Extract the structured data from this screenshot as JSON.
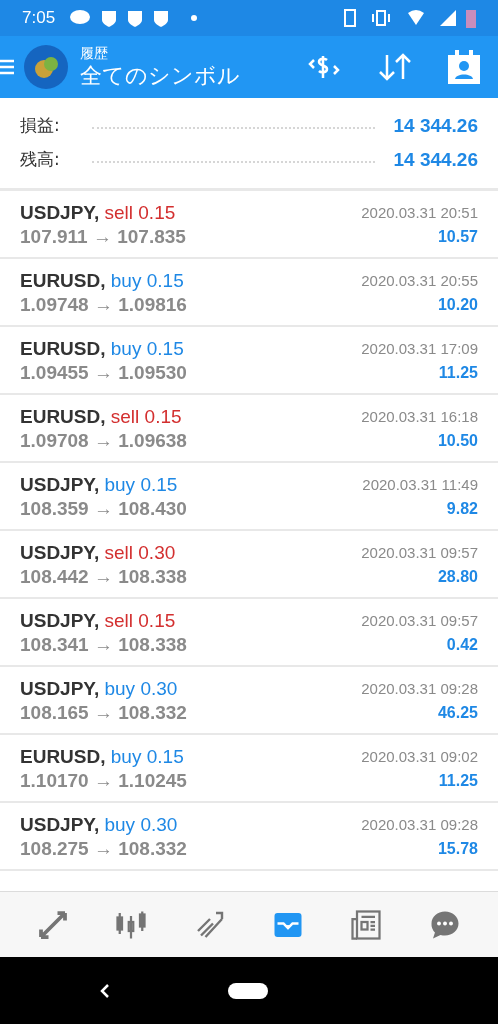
{
  "status_bar": {
    "time": "7:05"
  },
  "header": {
    "subtitle": "履歴",
    "title": "全てのシンボル"
  },
  "summary": [
    {
      "label": "損益:",
      "value": "14 344.26"
    },
    {
      "label": "残高:",
      "value": "14 344.26"
    }
  ],
  "trades": [
    {
      "symbol": "USDJPY,",
      "side": "sell",
      "lot": "0.15",
      "prices": "107.911 → 107.835",
      "time": "2020.03.31 20:51",
      "profit": "10.57"
    },
    {
      "symbol": "EURUSD,",
      "side": "buy",
      "lot": "0.15",
      "prices": "1.09748 → 1.09816",
      "time": "2020.03.31 20:55",
      "profit": "10.20"
    },
    {
      "symbol": "EURUSD,",
      "side": "buy",
      "lot": "0.15",
      "prices": "1.09455 → 1.09530",
      "time": "2020.03.31 17:09",
      "profit": "11.25"
    },
    {
      "symbol": "EURUSD,",
      "side": "sell",
      "lot": "0.15",
      "prices": "1.09708 → 1.09638",
      "time": "2020.03.31 16:18",
      "profit": "10.50"
    },
    {
      "symbol": "USDJPY,",
      "side": "buy",
      "lot": "0.15",
      "prices": "108.359 → 108.430",
      "time": "2020.03.31 11:49",
      "profit": "9.82"
    },
    {
      "symbol": "USDJPY,",
      "side": "sell",
      "lot": "0.30",
      "prices": "108.442 → 108.338",
      "time": "2020.03.31 09:57",
      "profit": "28.80"
    },
    {
      "symbol": "USDJPY,",
      "side": "sell",
      "lot": "0.15",
      "prices": "108.341 → 108.338",
      "time": "2020.03.31 09:57",
      "profit": "0.42"
    },
    {
      "symbol": "USDJPY,",
      "side": "buy",
      "lot": "0.30",
      "prices": "108.165 → 108.332",
      "time": "2020.03.31 09:28",
      "profit": "46.25"
    },
    {
      "symbol": "EURUSD,",
      "side": "buy",
      "lot": "0.15",
      "prices": "1.10170 → 1.10245",
      "time": "2020.03.31 09:02",
      "profit": "11.25"
    },
    {
      "symbol": "USDJPY,",
      "side": "buy",
      "lot": "0.30",
      "prices": "108.275 → 108.332",
      "time": "2020.03.31 09:28",
      "profit": "15.78"
    }
  ],
  "bottom_nav": [
    {
      "kind": "quotes",
      "selected": false
    },
    {
      "kind": "chart",
      "selected": false
    },
    {
      "kind": "trade",
      "selected": false
    },
    {
      "kind": "history",
      "selected": true
    },
    {
      "kind": "news",
      "selected": false
    },
    {
      "kind": "chat",
      "selected": false
    }
  ]
}
